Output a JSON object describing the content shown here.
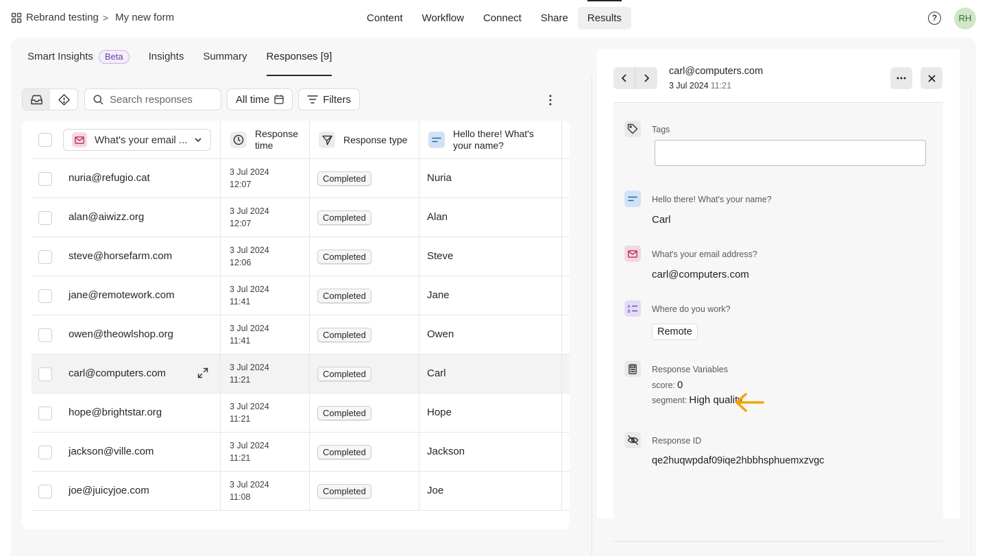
{
  "breadcrumb": {
    "workspace": "Rebrand testing",
    "separator": ">",
    "form": "My new form"
  },
  "main_nav": [
    {
      "label": "Content"
    },
    {
      "label": "Workflow"
    },
    {
      "label": "Connect"
    },
    {
      "label": "Share"
    },
    {
      "label": "Results",
      "active": true
    }
  ],
  "help_glyph": "?",
  "user": {
    "initials": "RH"
  },
  "sub_tabs": {
    "smart_insights": "Smart Insights",
    "beta": "Beta",
    "insights": "Insights",
    "summary": "Summary",
    "responses": "Responses [9]"
  },
  "toolbar": {
    "search_placeholder": "Search responses",
    "time_filter": "All time",
    "filters": "Filters"
  },
  "table": {
    "columns": {
      "email": "What's your email ...",
      "response_time_1": "Response",
      "response_time_2": "time",
      "response_type": "Response type",
      "name_1": "Hello there! What's",
      "name_2": "your name?"
    },
    "rows": [
      {
        "email": "nuria@refugio.cat",
        "date": "3 Jul 2024",
        "time": "12:07",
        "type": "Completed",
        "name": "Nuria"
      },
      {
        "email": "alan@aiwizz.org",
        "date": "3 Jul 2024",
        "time": "12:07",
        "type": "Completed",
        "name": "Alan"
      },
      {
        "email": "steve@horsefarm.com",
        "date": "3 Jul 2024",
        "time": "12:06",
        "type": "Completed",
        "name": "Steve"
      },
      {
        "email": "jane@remotework.com",
        "date": "3 Jul 2024",
        "time": "11:41",
        "type": "Completed",
        "name": "Jane"
      },
      {
        "email": "owen@theowlshop.org",
        "date": "3 Jul 2024",
        "time": "11:41",
        "type": "Completed",
        "name": "Owen"
      },
      {
        "email": "carl@computers.com",
        "date": "3 Jul 2024",
        "time": "11:21",
        "type": "Completed",
        "name": "Carl",
        "selected": true
      },
      {
        "email": "hope@brightstar.org",
        "date": "3 Jul 2024",
        "time": "11:21",
        "type": "Completed",
        "name": "Hope"
      },
      {
        "email": "jackson@ville.com",
        "date": "3 Jul 2024",
        "time": "11:21",
        "type": "Completed",
        "name": "Jackson"
      },
      {
        "email": "joe@juicyjoe.com",
        "date": "3 Jul 2024",
        "time": "11:08",
        "type": "Completed",
        "name": "Joe"
      }
    ]
  },
  "detail": {
    "email": "carl@computers.com",
    "date": "3 Jul 2024",
    "time": "11:21",
    "tags_label": "Tags",
    "name_question": "Hello there! What's your name?",
    "name_answer": "Carl",
    "email_question": "What's your email address?",
    "email_answer": "carl@computers.com",
    "work_question": "Where do you work?",
    "work_answer": "Remote",
    "variables_label": "Response Variables",
    "score_key": "score:",
    "score_value": "0",
    "segment_key": "segment:",
    "segment_value": "High quality",
    "response_id_label": "Response ID",
    "response_id": "qe2huqwpdaf09iqe2hbbhsphuemxzvgc"
  },
  "colors": {
    "email_icon_bg": "#f5d7df",
    "text_icon_bg": "#cfe2f7",
    "choice_icon_bg": "#e3dcf5",
    "arrow": "#f5a300",
    "avatar_bg": "#cfe6c9"
  }
}
